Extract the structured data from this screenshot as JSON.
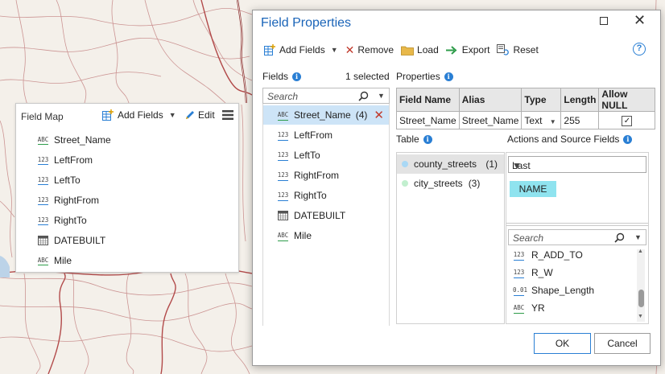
{
  "field_map": {
    "title": "Field Map",
    "add_fields_label": "Add Fields",
    "edit_label": "Edit",
    "fields": [
      {
        "type": "ABC",
        "name": "Street_Name"
      },
      {
        "type": "123",
        "name": "LeftFrom"
      },
      {
        "type": "123",
        "name": "LeftTo"
      },
      {
        "type": "123",
        "name": "RightFrom"
      },
      {
        "type": "123",
        "name": "RightTo"
      },
      {
        "type": "date",
        "name": "DATEBUILT"
      },
      {
        "type": "ABC",
        "name": "Mile"
      }
    ]
  },
  "dialog": {
    "title": "Field Properties",
    "toolbar": {
      "add_fields": "Add Fields",
      "remove": "Remove",
      "load": "Load",
      "export": "Export",
      "reset": "Reset"
    },
    "fields_section": {
      "label": "Fields",
      "selected_count": "1 selected",
      "search_placeholder": "Search",
      "items": [
        {
          "type": "ABC",
          "name": "Street_Name",
          "count": "(4)",
          "selected": true
        },
        {
          "type": "123",
          "name": "LeftFrom"
        },
        {
          "type": "123",
          "name": "LeftTo"
        },
        {
          "type": "123",
          "name": "RightFrom"
        },
        {
          "type": "123",
          "name": "RightTo"
        },
        {
          "type": "date",
          "name": "DATEBUILT"
        },
        {
          "type": "ABC",
          "name": "Mile"
        }
      ]
    },
    "properties": {
      "label": "Properties",
      "headers": [
        "Field Name",
        "Alias",
        "Type",
        "Length",
        "Allow NULL"
      ],
      "row": {
        "field_name": "Street_Name",
        "alias": "Street_Name",
        "type": "Text",
        "length": "255",
        "allow_null": true
      }
    },
    "table_section": {
      "label": "Table",
      "items": [
        {
          "name": "county_streets",
          "count": "(1)",
          "color": "#a9d8f5",
          "selected": true
        },
        {
          "name": "city_streets",
          "count": "(3)",
          "color": "#c2efcf",
          "selected": false
        }
      ]
    },
    "actions": {
      "label": "Actions and Source Fields",
      "action_value": "Last",
      "source_chip": "NAME",
      "search_placeholder": "Search",
      "source_fields": [
        {
          "type": "123",
          "name": "R_ADD_TO"
        },
        {
          "type": "123",
          "name": "R_W"
        },
        {
          "type": "0.01",
          "name": "Shape_Length"
        },
        {
          "type": "ABC",
          "name": "YR"
        }
      ]
    },
    "buttons": {
      "ok": "OK",
      "cancel": "Cancel"
    }
  },
  "colors": {
    "accent": "#1a64b8",
    "selection": "#cde4f7",
    "chip": "#8fe3ef",
    "road": "#b24a4a"
  }
}
